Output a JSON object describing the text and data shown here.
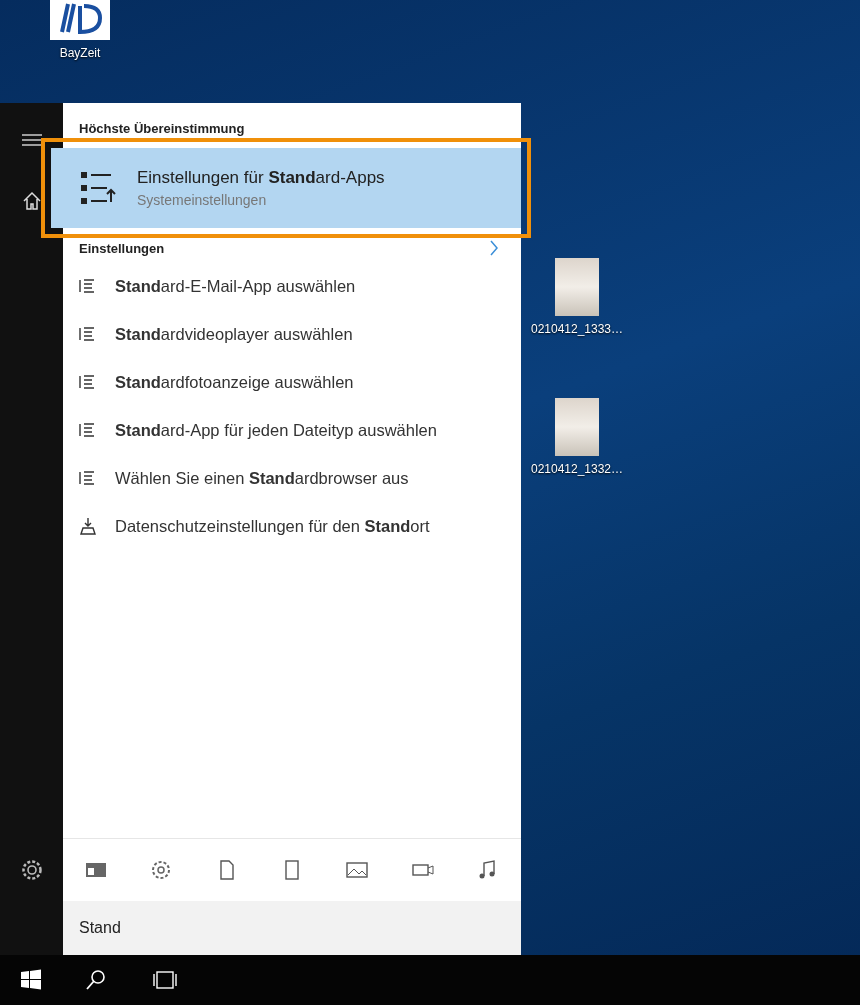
{
  "desktop_icons": [
    {
      "kind": "app",
      "label": "BayZeit"
    },
    {
      "kind": "photo",
      "label": "0210412_1333…"
    },
    {
      "kind": "photo",
      "label": "0210412_1332…"
    }
  ],
  "start_menu": {
    "best_match": {
      "heading": "Höchste Übereinstimmung",
      "title": "Einstellungen für **Stand**ard-Apps",
      "subtitle": "Systemeinstellungen",
      "selected": true,
      "outlined": true
    },
    "settings": {
      "heading": "Einstellungen",
      "items": [
        {
          "kind": "list",
          "label": "**Stand**ard-E-Mail-App auswählen",
          "selected": false
        },
        {
          "kind": "list",
          "label": "**Stand**ardvideoplayer auswählen",
          "selected": false
        },
        {
          "kind": "list",
          "label": "**Stand**ardfotoanzeige auswählen",
          "selected": false
        },
        {
          "kind": "list",
          "label": "**Stand**ard-App für jeden Dateityp auswählen",
          "selected": false
        },
        {
          "kind": "list",
          "label": "Wählen Sie einen **Stand**ardbrowser aus",
          "selected": false
        },
        {
          "kind": "location",
          "label": "Datenschutzeinstellungen für den **Stand**ort",
          "selected": false
        }
      ]
    },
    "filters": [
      {
        "kind": "apps"
      },
      {
        "kind": "settings"
      },
      {
        "kind": "documents"
      },
      {
        "kind": "tablet"
      },
      {
        "kind": "photos"
      },
      {
        "kind": "videos"
      },
      {
        "kind": "music"
      }
    ],
    "search": {
      "value": "Stand"
    }
  }
}
